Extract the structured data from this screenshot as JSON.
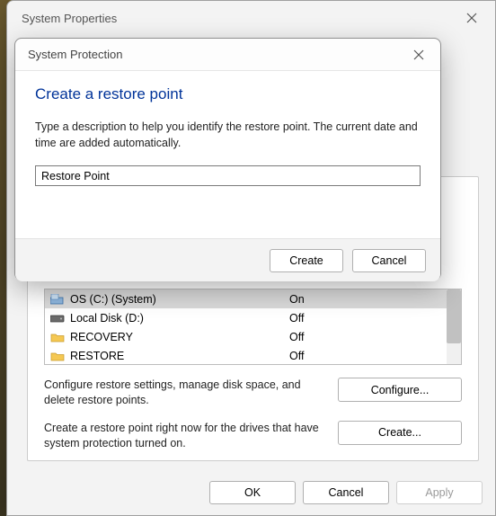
{
  "outer": {
    "title": "System Properties",
    "buttons": {
      "ok": "OK",
      "cancel": "Cancel",
      "apply": "Apply"
    },
    "configure_text": "Configure restore settings, manage disk space, and delete restore points.",
    "configure_btn": "Configure...",
    "create_text": "Create a restore point right now for the drives that have system protection turned on.",
    "create_btn": "Create..."
  },
  "drives": [
    {
      "name": "OS (C:) (System)",
      "status": "On",
      "icon": "drive-os"
    },
    {
      "name": "Local Disk (D:)",
      "status": "Off",
      "icon": "drive-hdd"
    },
    {
      "name": "RECOVERY",
      "status": "Off",
      "icon": "folder"
    },
    {
      "name": "RESTORE",
      "status": "Off",
      "icon": "folder"
    }
  ],
  "modal": {
    "title": "System Protection",
    "heading": "Create a restore point",
    "description": "Type a description to help you identify the restore point. The current date and time are added automatically.",
    "input_value": "Restore Point",
    "create": "Create",
    "cancel": "Cancel"
  }
}
